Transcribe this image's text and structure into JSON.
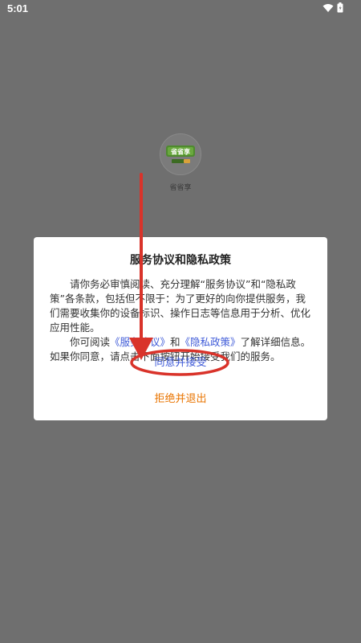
{
  "status_bar": {
    "time": "5:01",
    "icons": [
      "wifi-icon",
      "battery-icon"
    ]
  },
  "app": {
    "name": "省省享",
    "icon_text": "省省享"
  },
  "dialog": {
    "title": "服务协议和隐私政策",
    "para1": "请你务必审慎阅读、充分理解“服务协议”和“隐私政策”各条款，包括但不限于：为了更好的向你提供服务，我们需要收集你的设备标识、操作日志等信息用于分析、优化应用性能。",
    "para2_prefix": "你可阅读",
    "service_link": "《服务协议》",
    "para2_and": "和",
    "privacy_link": "《隐私政策》",
    "para2_suffix": "了解详细信息。如果你同意，请点击下面按钮开始接受我们的服务。",
    "accept_label": "同意并接受",
    "reject_label": "拒绝并退出"
  },
  "colors": {
    "overlay": "#6f6f6f",
    "link": "#3f5bd8",
    "reject": "#e97400",
    "annotation": "#d9332a"
  }
}
